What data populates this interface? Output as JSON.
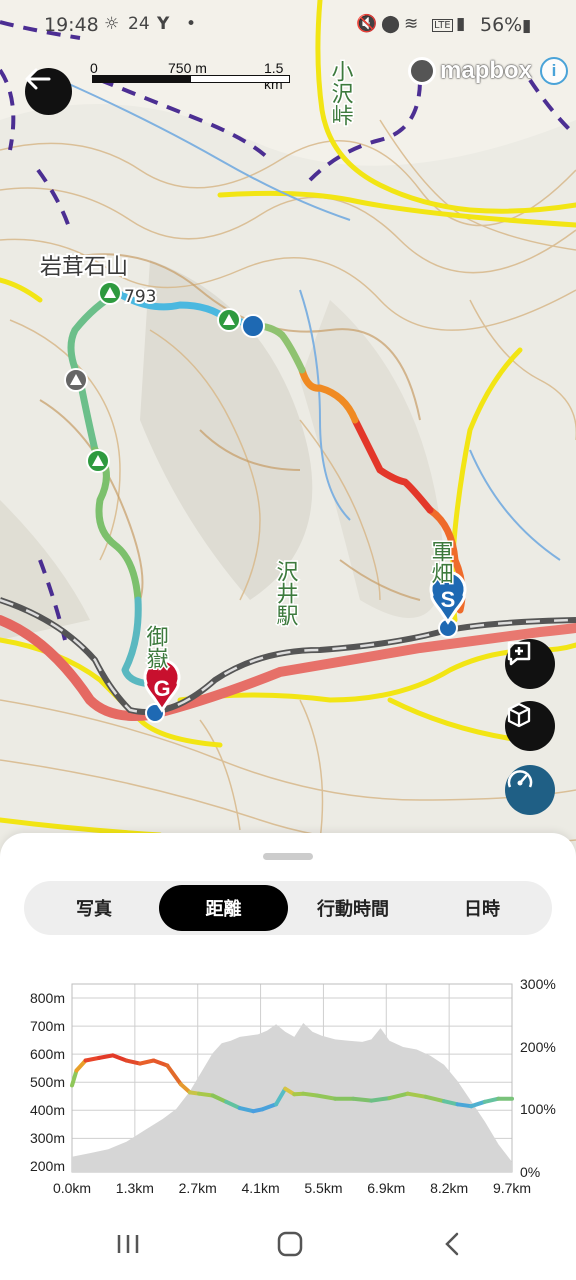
{
  "status_bar": {
    "time": "19:48",
    "temperature": "24",
    "battery": "56%"
  },
  "map": {
    "scale": {
      "zero": "0",
      "mid": "750 m",
      "end": "1.5 km"
    },
    "attribution": "mapbox",
    "place_labels": [
      {
        "text": "岩茸石山"
      },
      {
        "text": "793"
      },
      {
        "text": "小沢峠"
      },
      {
        "text": "沢井駅"
      },
      {
        "text": "御嶽"
      },
      {
        "text": "軍畑"
      }
    ],
    "start_marker": "S",
    "goal_marker": "G",
    "icons": [
      "back-arrow-icon",
      "mapbox-logo-icon",
      "info-icon",
      "add-comment-icon",
      "3d-cube-icon",
      "speedometer-icon"
    ]
  },
  "tabs": [
    {
      "label": "写真",
      "active": false
    },
    {
      "label": "距離",
      "active": true
    },
    {
      "label": "行動時間",
      "active": false
    },
    {
      "label": "日時",
      "active": false
    }
  ],
  "chart_data": {
    "type": "line",
    "xlabel": "",
    "ylabel": "",
    "x_ticks": [
      "0.0km",
      "1.3km",
      "2.7km",
      "4.1km",
      "5.5km",
      "6.9km",
      "8.2km",
      "9.7km"
    ],
    "y_left_ticks": [
      "800m",
      "700m",
      "600m",
      "500m",
      "400m",
      "300m",
      "200m"
    ],
    "y_right_ticks": [
      "300%",
      "200%",
      "100%",
      "0%"
    ],
    "x_range_km": [
      0,
      9.7
    ],
    "y_left_range_m": [
      180,
      850
    ],
    "y_right_range_pct": [
      0,
      300
    ],
    "series": [
      {
        "kind": "elevation_area",
        "color": "#d6d6d6",
        "x": [
          0,
          0.4,
          0.8,
          1.2,
          1.6,
          2.0,
          2.3,
          2.6,
          2.9,
          3.1,
          3.3,
          3.5,
          3.7,
          3.9,
          4.1,
          4.3,
          4.5,
          4.7,
          4.9,
          5.1,
          5.3,
          5.5,
          5.8,
          6.1,
          6.4,
          6.6,
          6.8,
          7.0,
          7.3,
          7.6,
          7.9,
          8.2,
          8.5,
          8.8,
          9.1,
          9.4,
          9.7
        ],
        "y": [
          240,
          255,
          270,
          300,
          345,
          390,
          430,
          500,
          590,
          650,
          690,
          700,
          715,
          720,
          725,
          740,
          765,
          735,
          715,
          770,
          735,
          720,
          705,
          700,
          695,
          705,
          750,
          700,
          675,
          665,
          640,
          605,
          540,
          460,
          380,
          290,
          220
        ]
      },
      {
        "kind": "grade_line",
        "x": [
          0,
          0.1,
          0.3,
          0.6,
          0.9,
          1.2,
          1.5,
          1.8,
          2.1,
          2.4,
          2.6,
          2.8,
          3.1,
          3.4,
          3.7,
          4.0,
          4.2,
          4.5,
          4.7,
          4.9,
          5.1,
          5.4,
          5.8,
          6.2,
          6.6,
          7.0,
          7.4,
          7.8,
          8.2,
          8.5,
          8.8,
          9.1,
          9.4,
          9.7
        ],
        "y": [
          138,
          162,
          178,
          182,
          186,
          178,
          173,
          178,
          170,
          140,
          127,
          125,
          122,
          112,
          102,
          97,
          100,
          108,
          133,
          124,
          125,
          122,
          117,
          117,
          114,
          118,
          125,
          120,
          113,
          108,
          105,
          112,
          117,
          117
        ],
        "colors": [
          "#8fc75a",
          "#e9a02a",
          "#e8452a",
          "#e23a28",
          "#e23a28",
          "#e24a2a",
          "#e8602a",
          "#e5582a",
          "#e26a2a",
          "#e59a30",
          "#c9c447",
          "#a8c84a",
          "#8bc457",
          "#60c2a0",
          "#4aa6d8",
          "#4a9ee0",
          "#4aa2dc",
          "#56bcc4",
          "#d8c442",
          "#a8c84a",
          "#9ac751",
          "#92c659",
          "#86c35f",
          "#7ec06c",
          "#6cbf86",
          "#8cc65a",
          "#a6c84d",
          "#93c65a",
          "#62c2a0",
          "#4aa6d8",
          "#50b0d0",
          "#66c2a0",
          "#79c27a",
          "#79c27a"
        ]
      }
    ]
  },
  "nav_bar": [
    "recent-apps-icon",
    "home-icon",
    "back-icon"
  ]
}
